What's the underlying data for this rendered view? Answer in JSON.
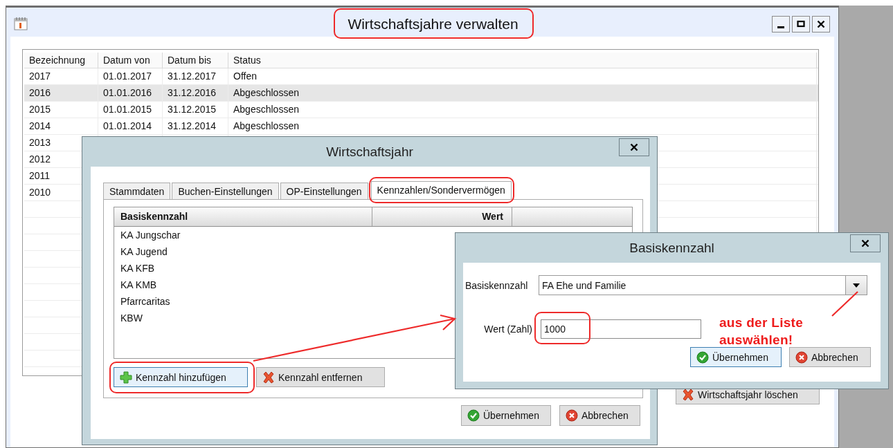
{
  "main_window": {
    "title": "Wirtschaftsjahre verwalten",
    "title_highlighted": true,
    "table": {
      "columns": [
        "Bezeichnung",
        "Datum von",
        "Datum bis",
        "Status"
      ],
      "rows": [
        {
          "cells": [
            "2017",
            "01.01.2017",
            "31.12.2017",
            "Offen"
          ],
          "selected": false
        },
        {
          "cells": [
            "2016",
            "01.01.2016",
            "31.12.2016",
            "Abgeschlossen"
          ],
          "selected": true
        },
        {
          "cells": [
            "2015",
            "01.01.2015",
            "31.12.2015",
            "Abgeschlossen"
          ],
          "selected": false
        },
        {
          "cells": [
            "2014",
            "01.01.2014",
            "31.12.2014",
            "Abgeschlossen"
          ],
          "selected": false
        },
        {
          "cells": [
            "2013"
          ],
          "selected": false
        },
        {
          "cells": [
            "2012"
          ],
          "selected": false
        },
        {
          "cells": [
            "2011"
          ],
          "selected": false
        },
        {
          "cells": [
            "2010"
          ],
          "selected": false
        }
      ]
    },
    "buttons": [
      {
        "label": "Wirtschaftsjahr löschen",
        "kind": "remove"
      }
    ]
  },
  "year_dialog": {
    "title": "Wirtschaftsjahr",
    "tabs": [
      {
        "label": "Stammdaten",
        "selected": false,
        "highlighted": false
      },
      {
        "label": "Buchen-Einstellungen",
        "selected": false,
        "highlighted": false
      },
      {
        "label": "OP-Einstellungen",
        "selected": false,
        "highlighted": false
      },
      {
        "label": "Kennzahlen/Sondervermögen",
        "selected": true,
        "highlighted": true
      }
    ],
    "list": {
      "columns": [
        "Basiskennzahl",
        "Wert"
      ],
      "rows": [
        "KA Jungschar",
        "KA Jugend",
        "KA KFB",
        "KA KMB",
        "Pfarrcaritas",
        "KBW"
      ]
    },
    "list_buttons": [
      {
        "label": "Kennzahl hinzufügen",
        "kind": "add",
        "focused": true,
        "highlighted": true
      },
      {
        "label": "Kennzahl entfernen",
        "kind": "remove",
        "focused": false,
        "highlighted": false
      }
    ],
    "footer_buttons": [
      {
        "label": "Übernehmen",
        "kind": "ok",
        "focused": false
      },
      {
        "label": "Abbrechen",
        "kind": "cancel",
        "focused": false
      }
    ]
  },
  "figure_dialog": {
    "title": "Basiskennzahl",
    "fields": [
      {
        "label": "Basiskennzahl",
        "kind": "combo",
        "value": "FA Ehe und Familie",
        "highlighted": false
      },
      {
        "label": "Wert (Zahl)",
        "kind": "text",
        "value": "1000",
        "highlighted": true
      }
    ],
    "note": "aus der Liste auswählen!",
    "buttons": [
      {
        "label": "Übernehmen",
        "kind": "ok",
        "focused": true
      },
      {
        "label": "Abbrechen",
        "kind": "cancel",
        "focused": false
      }
    ]
  }
}
